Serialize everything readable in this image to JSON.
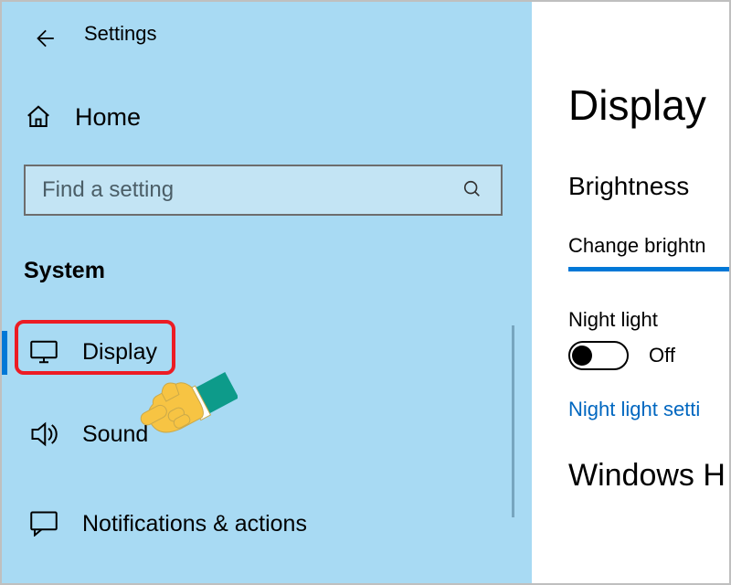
{
  "window": {
    "title": "Settings"
  },
  "sidebar": {
    "home_label": "Home",
    "search_placeholder": "Find a setting",
    "section_label": "System",
    "items": [
      {
        "label": "Display",
        "icon": "monitor-icon",
        "active": true
      },
      {
        "label": "Sound",
        "icon": "speaker-icon",
        "active": false
      },
      {
        "label": "Notifications & actions",
        "icon": "chat-icon",
        "active": false
      }
    ]
  },
  "content": {
    "page_title": "Display",
    "section_brightness": "Brightness ",
    "brightness_label": "Change brightn",
    "night_light_label": "Night light",
    "night_light_state": "Off",
    "night_light_link": "Night light setti",
    "section_windows": "Windows H"
  }
}
